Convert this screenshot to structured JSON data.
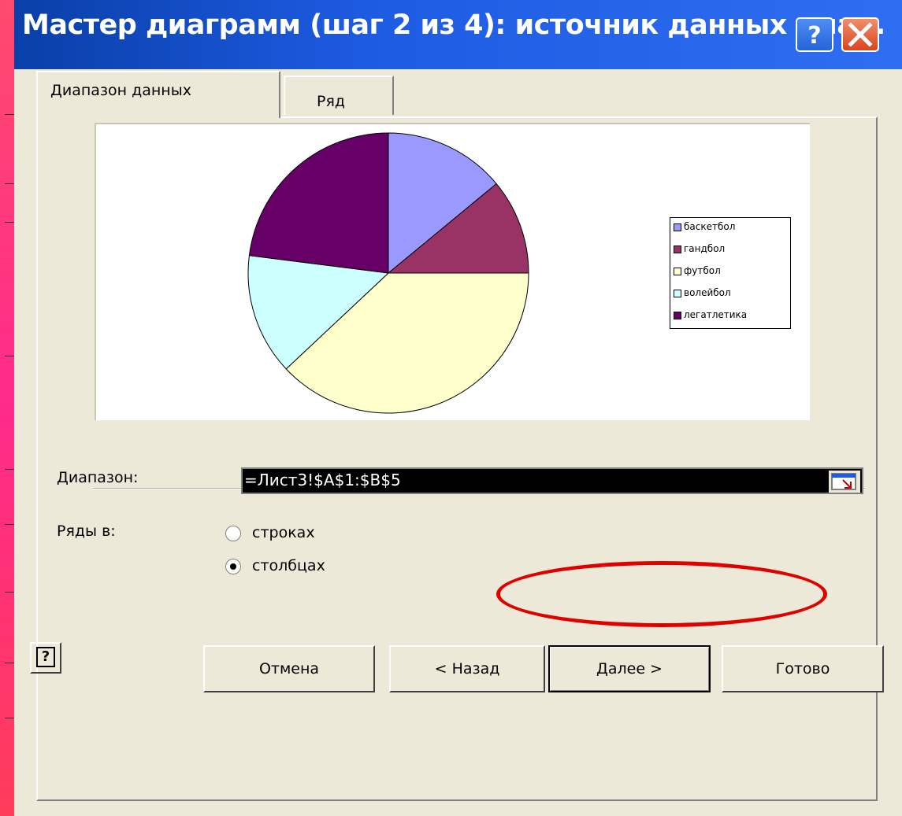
{
  "window": {
    "title": "Мастер диаграмм (шаг 2 из 4): источник данных диа...",
    "help_button_icon": "question-icon",
    "close_button_icon": "close-icon"
  },
  "tabs": [
    {
      "label": "Диапазон данных",
      "active": true
    },
    {
      "label": "Ряд",
      "active": false
    }
  ],
  "chart_data": {
    "type": "pie",
    "categories": [
      "баскетбол",
      "гандбол",
      "футбол",
      "волейбол",
      "легатлетика"
    ],
    "values": [
      14,
      11,
      38,
      14,
      23
    ],
    "colors": [
      "#9999ff",
      "#993366",
      "#ffffcc",
      "#ccffff",
      "#660066"
    ],
    "legend": [
      "баскетбол",
      "гандбол",
      "футбол",
      "волейбол",
      "легатлетика"
    ],
    "legend_position": "right"
  },
  "form": {
    "range_label": "Диапазон:",
    "range_value": "=Лист3!$A$1:$B$5",
    "series_in_label": "Ряды в:",
    "rows_option": "строках",
    "columns_option": "столбцах",
    "rows_selected": false,
    "columns_selected": true
  },
  "buttons": {
    "cancel": "Отмена",
    "back": "< Назад",
    "next": "Далее >",
    "finish": "Готово"
  },
  "colors": {
    "title_bar": "#1d5be3",
    "highlight": "#e00000",
    "dialog_bg": "#ece9d8"
  }
}
